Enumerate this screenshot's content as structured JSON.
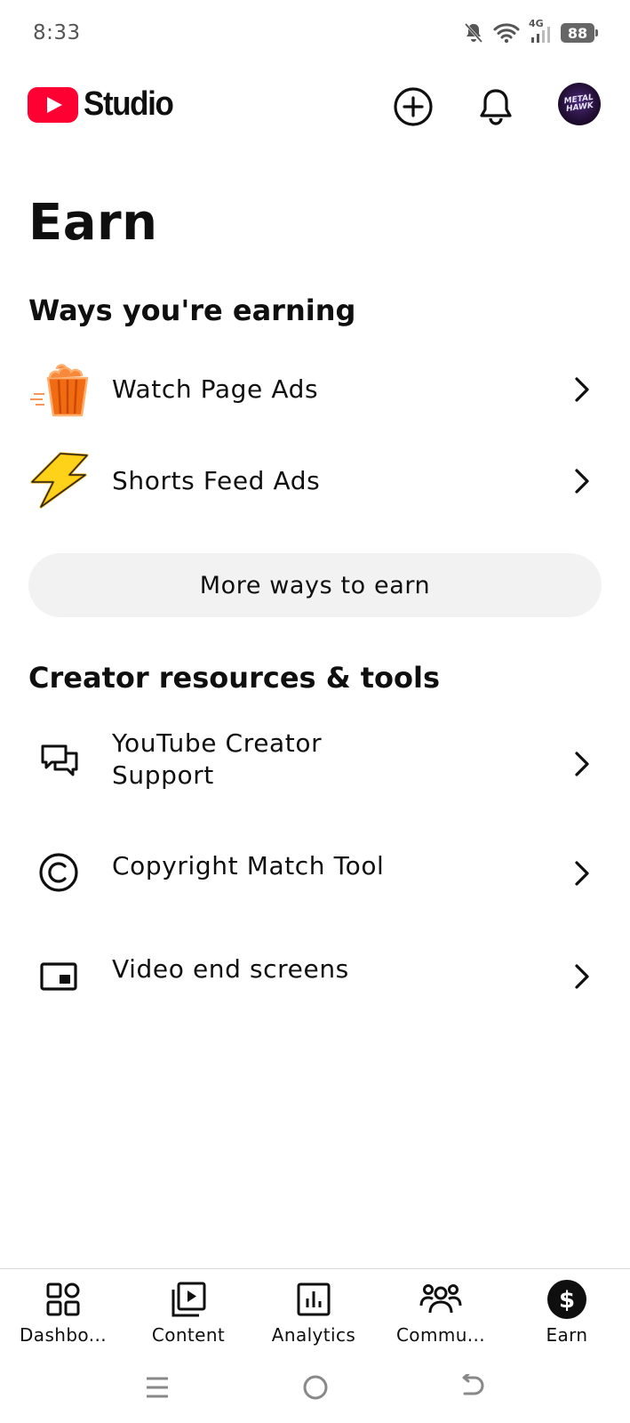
{
  "status_bar": {
    "time": "8:33",
    "network": "4G",
    "battery": "88"
  },
  "header": {
    "logo_text": "Studio",
    "create_icon": "plus-circle-icon",
    "notifications_icon": "bell-icon",
    "avatar_text": "METAL HAWK"
  },
  "page": {
    "title": "Earn"
  },
  "earning": {
    "section_title": "Ways you're earning",
    "items": [
      {
        "label": "Watch Page Ads",
        "icon": "popcorn-icon"
      },
      {
        "label": "Shorts Feed Ads",
        "icon": "lightning-icon"
      }
    ],
    "more_button": "More ways to earn"
  },
  "resources": {
    "section_title": "Creator resources & tools",
    "items": [
      {
        "label": "YouTube Creator Support",
        "icon": "chat-bubbles-icon"
      },
      {
        "label": "Copyright Match Tool",
        "icon": "copyright-icon"
      },
      {
        "label": "Video end screens",
        "icon": "end-screen-icon"
      }
    ]
  },
  "bottom_nav": {
    "items": [
      {
        "label": "Dashbo...",
        "icon": "dashboard-icon"
      },
      {
        "label": "Content",
        "icon": "content-icon"
      },
      {
        "label": "Analytics",
        "icon": "analytics-icon"
      },
      {
        "label": "Commu...",
        "icon": "community-icon"
      },
      {
        "label": "Earn",
        "icon": "dollar-icon",
        "active": true
      }
    ]
  },
  "colors": {
    "brand_red": "#ff0033",
    "text": "#0f0f0f",
    "pill_bg": "#f2f2f2",
    "popcorn_orange": "#f26a12",
    "lightning_yellow": "#ffd21a"
  }
}
